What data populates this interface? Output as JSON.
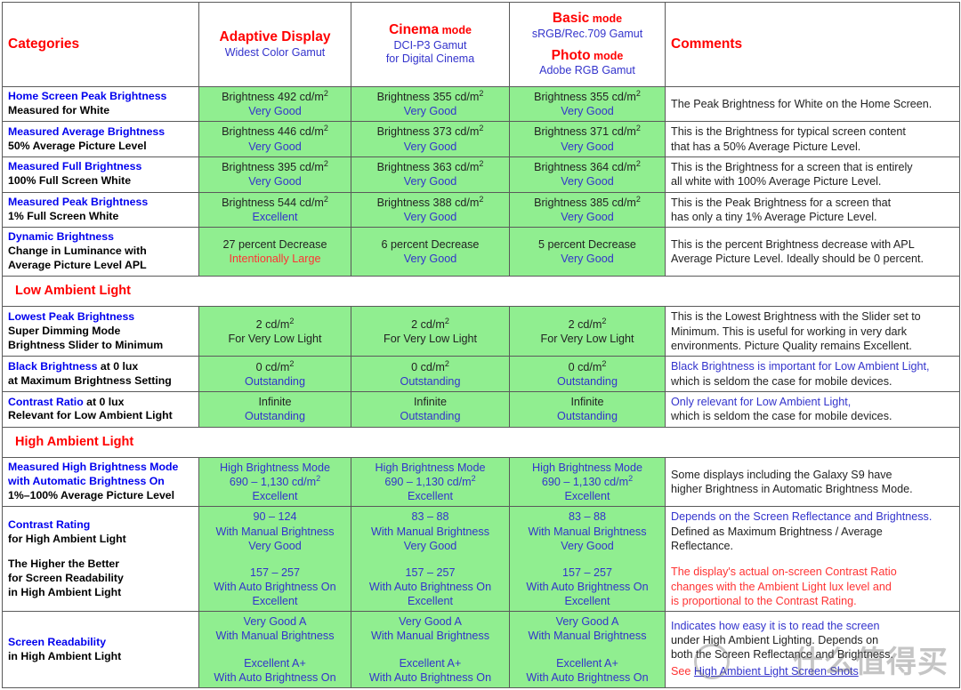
{
  "header": {
    "categories_label": "Categories",
    "comments_label": "Comments",
    "modes": [
      {
        "name": "Adaptive Display",
        "name_small": "",
        "sub": "Widest Color Gamut",
        "sub2": "",
        "name2": "",
        "name2_small": "",
        "sub3": ""
      },
      {
        "name": "Cinema",
        "name_small": " mode",
        "sub": "DCI-P3 Gamut",
        "sub2": "for Digital Cinema",
        "name2": "",
        "name2_small": "",
        "sub3": ""
      },
      {
        "name": "Basic",
        "name_small": " mode",
        "sub": "sRGB/Rec.709 Gamut",
        "sub2": "",
        "name2": "Photo",
        "name2_small": " mode",
        "sub3": "Adobe RGB Gamut"
      }
    ]
  },
  "colors": {
    "accent_red": "#ff0000",
    "link_blue": "#0000ee",
    "value_blue": "#3333cc",
    "cell_green": "#90ee90",
    "warn_red": "#ff3333",
    "border": "#5a5a5a"
  },
  "rows": [
    {
      "type": "data",
      "cat": {
        "line1": "Home Screen Peak Brightness",
        "line2": "Measured for White",
        "line3": "",
        "spacer": false,
        "line4": "",
        "line5": "",
        "line6": ""
      },
      "cols": [
        {
          "v1": "Brightness 492 cd/m",
          "sup1": "2",
          "v2": "Very Good"
        },
        {
          "v1": "Brightness 355 cd/m",
          "sup1": "2",
          "v2": "Very Good"
        },
        {
          "v1": "Brightness 355 cd/m",
          "sup1": "2",
          "v2": "Very Good"
        }
      ],
      "comment": {
        "c1": "The Peak Brightness for White on the Home Screen.",
        "c2": "",
        "c3": "",
        "c4": ""
      }
    },
    {
      "type": "data",
      "cat": {
        "line1": "Measured Average Brightness",
        "line2": "50% Average Picture Level",
        "line3": ""
      },
      "cols": [
        {
          "v1": "Brightness 446 cd/m",
          "sup1": "2",
          "v2": "Very Good"
        },
        {
          "v1": "Brightness 373 cd/m",
          "sup1": "2",
          "v2": "Very Good"
        },
        {
          "v1": "Brightness 371 cd/m",
          "sup1": "2",
          "v2": "Very Good"
        }
      ],
      "comment": {
        "c1": "This is the Brightness for typical screen content",
        "c2": "that has a 50% Average Picture Level.",
        "c3": "",
        "c4": ""
      }
    },
    {
      "type": "data",
      "cat": {
        "line1": "Measured Full Brightness",
        "line2": "100% Full Screen White",
        "line3": ""
      },
      "cols": [
        {
          "v1": "Brightness 395 cd/m",
          "sup1": "2",
          "v2": "Very Good"
        },
        {
          "v1": "Brightness 363 cd/m",
          "sup1": "2",
          "v2": "Very Good"
        },
        {
          "v1": "Brightness 364 cd/m",
          "sup1": "2",
          "v2": "Very Good"
        }
      ],
      "comment": {
        "c1": "This is the Brightness for a screen that is entirely",
        "c2": "all white with 100% Average Picture Level.",
        "c3": "",
        "c4": ""
      }
    },
    {
      "type": "data",
      "cat": {
        "line1": "Measured Peak Brightness",
        "line2": "1% Full Screen White",
        "line3": ""
      },
      "cols": [
        {
          "v1": "Brightness 544 cd/m",
          "sup1": "2",
          "v2": "Excellent"
        },
        {
          "v1": "Brightness 388 cd/m",
          "sup1": "2",
          "v2": "Very Good"
        },
        {
          "v1": "Brightness 385 cd/m",
          "sup1": "2",
          "v2": "Very Good"
        }
      ],
      "comment": {
        "c1": "This is the Peak Brightness for a screen that",
        "c2": "has only a tiny 1% Average Picture Level.",
        "c3": "",
        "c4": ""
      }
    },
    {
      "type": "data",
      "cat": {
        "line1": "Dynamic Brightness",
        "line2": "Change in Luminance with",
        "line3": "Average Picture Level APL"
      },
      "cols": [
        {
          "v1": "27 percent Decrease",
          "sup1": "",
          "v2": "Intentionally Large",
          "v2_style": "red"
        },
        {
          "v1": "6 percent Decrease",
          "sup1": "",
          "v2": "Very Good"
        },
        {
          "v1": "5 percent Decrease",
          "sup1": "",
          "v2": "Very Good"
        }
      ],
      "comment": {
        "c1": "This is the percent Brightness decrease with APL",
        "c2": "Average Picture Level. Ideally should be 0 percent.",
        "c3": "",
        "c4": ""
      }
    },
    {
      "type": "section",
      "title": "Low Ambient Light"
    },
    {
      "type": "data",
      "cat": {
        "line1": "Lowest Peak Brightness",
        "line2": "Super Dimming Mode",
        "line3": "Brightness Slider to Minimum"
      },
      "cols": [
        {
          "v1": "2 cd/m",
          "sup1": "2",
          "v2": "For Very Low Light",
          "v2_style": "dark"
        },
        {
          "v1": "2 cd/m",
          "sup1": "2",
          "v2": "For Very Low Light",
          "v2_style": "dark"
        },
        {
          "v1": "2 cd/m",
          "sup1": "2",
          "v2": "For Very Low Light",
          "v2_style": "dark"
        }
      ],
      "comment": {
        "c1": "This is the Lowest Brightness with the Slider set to",
        "c2": "Minimum. This is useful for working in very dark",
        "c3": "environments. Picture Quality remains Excellent.",
        "c4": ""
      }
    },
    {
      "type": "data",
      "cat": {
        "mix1_blue": "Black Brightness",
        "mix1_black": " at 0 lux",
        "line2": "at Maximum Brightness Setting",
        "line3": ""
      },
      "cols": [
        {
          "v1": "0 cd/m",
          "sup1": "2",
          "v2": "Outstanding"
        },
        {
          "v1": "0 cd/m",
          "sup1": "2",
          "v2": "Outstanding"
        },
        {
          "v1": "0 cd/m",
          "sup1": "2",
          "v2": "Outstanding"
        }
      ],
      "comment": {
        "c1": "Black Brightness is important for Low Ambient Light,",
        "c1_style": "blue",
        "c2": "which is seldom the case for mobile devices.",
        "c3": "",
        "c4": ""
      }
    },
    {
      "type": "data",
      "cat": {
        "mix1_blue": "Contrast Ratio",
        "mix1_black": " at 0 lux",
        "line2": "Relevant for Low Ambient Light",
        "line3": ""
      },
      "cols": [
        {
          "v1": "Infinite",
          "sup1": "",
          "v2": "Outstanding"
        },
        {
          "v1": "Infinite",
          "sup1": "",
          "v2": "Outstanding"
        },
        {
          "v1": "Infinite",
          "sup1": "",
          "v2": "Outstanding"
        }
      ],
      "comment": {
        "c1": "Only relevant for Low Ambient Light,",
        "c1_style": "blue",
        "c2": "which is seldom the case for mobile devices.",
        "c3": "",
        "c4": ""
      }
    },
    {
      "type": "section",
      "title": "High Ambient Light"
    },
    {
      "type": "data",
      "cat": {
        "line1": "Measured High Brightness Mode",
        "line2": "with Automatic Brightness On",
        "line2_style": "blue",
        "line3": "1%–100% Average Picture Level"
      },
      "cols": [
        {
          "v0": "High Brightness Mode",
          "v1": "690 – 1,130 cd/m",
          "sup1": "2",
          "v2": "Excellent",
          "v1_style": "blue"
        },
        {
          "v0": "High Brightness Mode",
          "v1": "690 – 1,130 cd/m",
          "sup1": "2",
          "v2": "Excellent",
          "v1_style": "blue"
        },
        {
          "v0": "High Brightness Mode",
          "v1": "690 – 1,130 cd/m",
          "sup1": "2",
          "v2": "Excellent",
          "v1_style": "blue"
        }
      ],
      "comment": {
        "c1": "Some displays including the Galaxy S9 have",
        "c2": "higher Brightness in Automatic Brightness Mode.",
        "c3": "",
        "c4": ""
      }
    },
    {
      "type": "data_double",
      "cat": {
        "line1": "Contrast Rating",
        "line2": "for High Ambient Light",
        "spacer": true,
        "line4": "The Higher the Better",
        "line5": "for Screen Readability",
        "line6": "in High Ambient Light"
      },
      "cols": [
        {
          "a1": "90 – 124",
          "a2": "With Manual Brightness",
          "a3": "Very Good",
          "b1": "157 – 257",
          "b2": "With Auto Brightness On",
          "b3": "Excellent"
        },
        {
          "a1": "83 – 88",
          "a2": "With Manual Brightness",
          "a3": "Very Good",
          "b1": "157 – 257",
          "b2": "With Auto Brightness On",
          "b3": "Excellent"
        },
        {
          "a1": "83 – 88",
          "a2": "With Manual Brightness",
          "a3": "Very Good",
          "b1": "157 – 257",
          "b2": "With Auto Brightness On",
          "b3": "Excellent"
        }
      ],
      "comment": {
        "c1": "Depends on the Screen Reflectance and Brightness.",
        "c1_style": "blue",
        "c2": "Defined as Maximum Brightness / Average",
        "c3": "Reflectance.",
        "gap": true,
        "c5": "The display's actual on-screen Contrast Ratio",
        "c6": "changes with the Ambient Light lux level and",
        "c7": "is proportional to the Contrast Rating."
      }
    },
    {
      "type": "data_double",
      "cat": {
        "line1": "Screen Readability",
        "line2": "in High Ambient Light",
        "line3": ""
      },
      "cols": [
        {
          "a1": "Very Good  A",
          "a2": "With Manual Brightness",
          "a3": "",
          "b1": "Excellent  A+",
          "b2": "With Auto Brightness On",
          "b3": ""
        },
        {
          "a1": "Very Good  A",
          "a2": "With Manual Brightness",
          "a3": "",
          "b1": "Excellent  A+",
          "b2": "With Auto Brightness On",
          "b3": ""
        },
        {
          "a1": "Very Good  A",
          "a2": "With Manual Brightness",
          "a3": "",
          "b1": "Excellent  A+",
          "b2": "With Auto Brightness On",
          "b3": ""
        }
      ],
      "comment": {
        "c1": "Indicates how easy it is to read the screen",
        "c1_style": "blue",
        "c2": "under High Ambient Lighting. Depends on",
        "c3": "both the Screen Reflectance and Brightness.",
        "see_prefix": "See ",
        "see_link": "High Ambient Light Screen Shots"
      }
    }
  ],
  "watermark": {
    "text": "什么值得买"
  }
}
